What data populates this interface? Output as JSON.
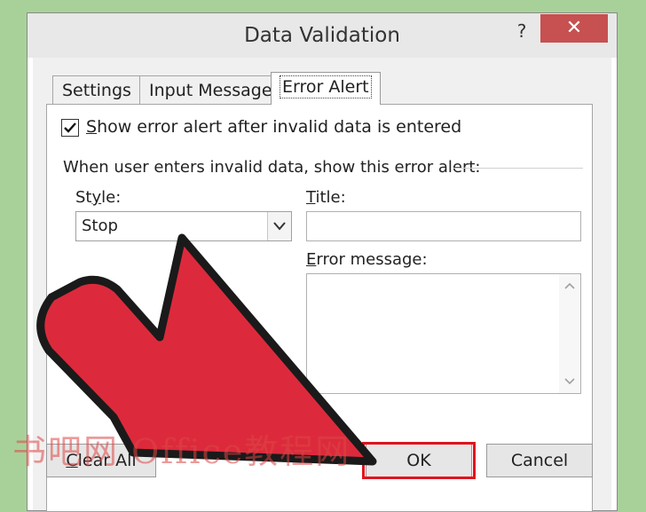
{
  "dialog": {
    "title": "Data Validation",
    "help_glyph": "?",
    "close_glyph": "✕"
  },
  "tabs": [
    {
      "label": "Settings",
      "active": false
    },
    {
      "label": "Input Message",
      "active": false
    },
    {
      "label": "Error Alert",
      "active": true
    }
  ],
  "error_alert": {
    "show_alert_checked": true,
    "show_alert_label_hotkey": "S",
    "show_alert_label_rest": "how error alert after invalid data is entered",
    "section_label": "When user enters invalid data, show this error alert:",
    "style_label_pre": "St",
    "style_label_hotkey": "y",
    "style_label_post": "le:",
    "style_value": "Stop",
    "title_label_hotkey": "T",
    "title_label_rest": "itle:",
    "title_value": "",
    "message_label_hotkey": "E",
    "message_label_rest": "rror message:",
    "message_value": ""
  },
  "buttons": {
    "clear_all_hotkey": "C",
    "clear_all_rest": "lear All",
    "ok": "OK",
    "cancel": "Cancel"
  },
  "watermark": "书吧网 Office教程网",
  "colors": {
    "background": "#a8d19a",
    "close_button": "#c75050",
    "arrow_fill": "#dc2a3c",
    "highlight": "#e0141e"
  },
  "icons": {
    "checkbox": "checkmark-icon",
    "dropdown": "chevron-down-icon",
    "pointer": "pointing-arrow-icon"
  }
}
